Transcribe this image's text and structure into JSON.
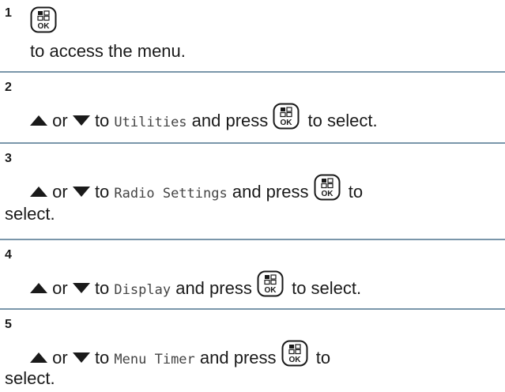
{
  "steps": [
    {
      "number": "1",
      "parts": {
        "suffix": "to access the menu."
      }
    },
    {
      "number": "2",
      "parts": {
        "or": "or",
        "to": "to",
        "menu_item": "Utilities",
        "and_press": "and press",
        "suffix": "to select."
      }
    },
    {
      "number": "3",
      "parts": {
        "or": "or",
        "to": "to",
        "menu_item": "Radio Settings",
        "and_press": "and press",
        "suffix_a": "to",
        "suffix_b": "select."
      }
    },
    {
      "number": "4",
      "parts": {
        "or": "or",
        "to": "to",
        "menu_item": "Display",
        "and_press": "and press",
        "suffix": "to select."
      }
    },
    {
      "number": "5",
      "parts": {
        "or": "or",
        "to": "to",
        "menu_item": "Menu Timer",
        "and_press": "and press",
        "suffix_a": "to",
        "suffix_b": "select."
      }
    }
  ],
  "key_label": "OK",
  "colors": {
    "divider": "#7a96aa",
    "text": "#1a1a1a"
  }
}
